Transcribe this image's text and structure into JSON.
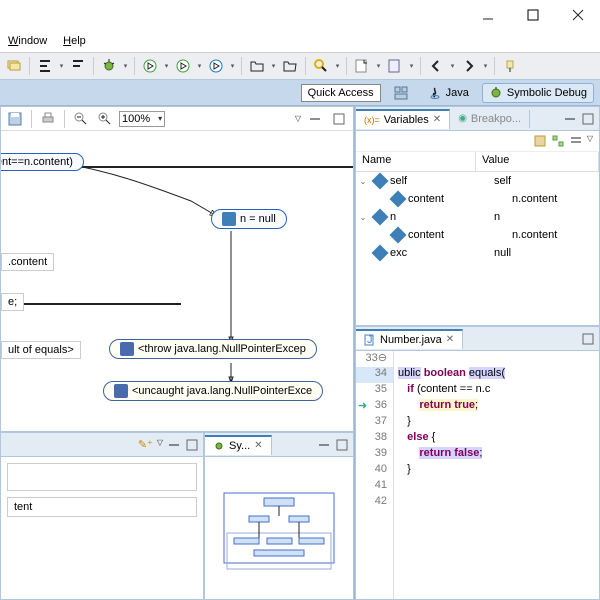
{
  "menus": {
    "window": "Window",
    "help": "Help"
  },
  "qa": {
    "label": "Quick Access"
  },
  "perspectives": {
    "java": "Java",
    "symdebug": "Symbolic Debug"
  },
  "toolbar": {
    "zoom_value": "100%"
  },
  "variables": {
    "tab": "Variables",
    "breakpoints_tab": "Breakpo...",
    "col_name": "Name",
    "col_value": "Value",
    "rows": [
      {
        "name": "self",
        "value": "self",
        "expandable": true,
        "level": 0
      },
      {
        "name": "content",
        "value": "n.content",
        "expandable": false,
        "level": 1
      },
      {
        "name": "n",
        "value": "n",
        "expandable": true,
        "level": 0
      },
      {
        "name": "content",
        "value": "n.content",
        "expandable": false,
        "level": 1
      },
      {
        "name": "exc",
        "value": "null",
        "expandable": false,
        "level": 0
      }
    ]
  },
  "editor": {
    "tab": "Number.java",
    "lines": [
      {
        "num": "33",
        "text": ""
      },
      {
        "num": "34",
        "text": "ublic boolean equals("
      },
      {
        "num": "35",
        "text": "   if (content == n.c"
      },
      {
        "num": "36",
        "text": "       return true;"
      },
      {
        "num": "37",
        "text": "   }"
      },
      {
        "num": "38",
        "text": "   else {"
      },
      {
        "num": "39",
        "text": "       return false;"
      },
      {
        "num": "40",
        "text": "   }"
      },
      {
        "num": "41",
        "text": ""
      },
      {
        "num": "42",
        "text": ""
      }
    ]
  },
  "flow": {
    "cond": ".content==n.content)",
    "nnull": "n = null",
    "content": ".content",
    "e": "e;",
    "result": "ult of equals>",
    "throw": "<throw  java.lang.NullPointerExcep",
    "uncaught": "<uncaught java.lang.NullPointerExce"
  },
  "bottom": {
    "sy_tab": "Sy...",
    "field": "tent"
  }
}
